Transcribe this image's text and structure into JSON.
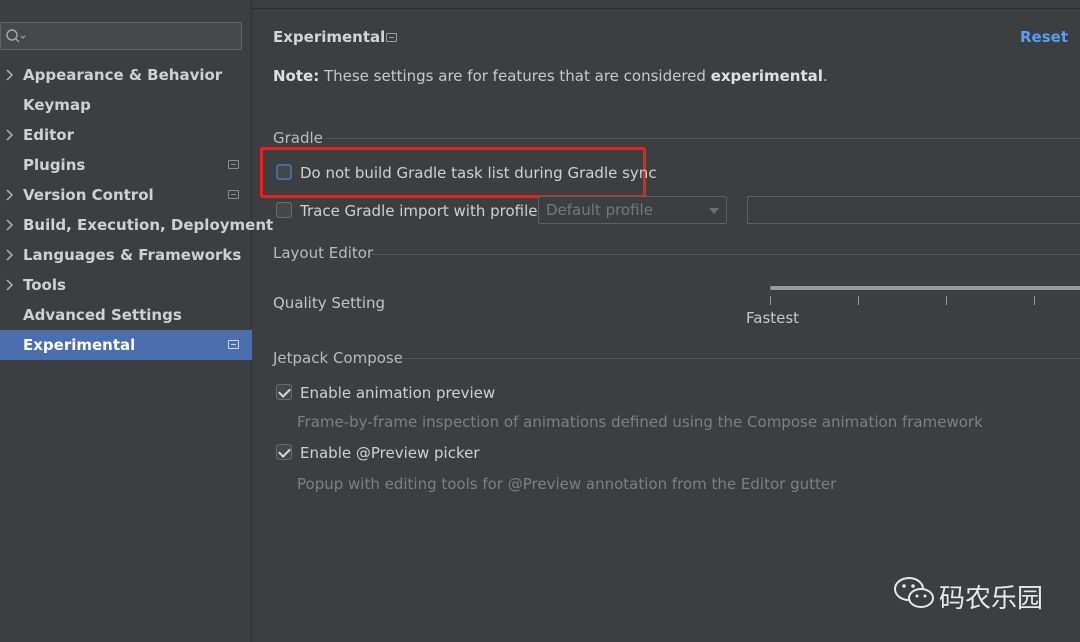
{
  "sidebar": {
    "search": {
      "value": "",
      "placeholder": ""
    },
    "items": [
      {
        "label": "Appearance & Behavior",
        "has_children": true,
        "badge": false,
        "selected": false
      },
      {
        "label": "Keymap",
        "has_children": false,
        "badge": false,
        "selected": false
      },
      {
        "label": "Editor",
        "has_children": true,
        "badge": false,
        "selected": false
      },
      {
        "label": "Plugins",
        "has_children": false,
        "badge": true,
        "selected": false
      },
      {
        "label": "Version Control",
        "has_children": true,
        "badge": true,
        "selected": false
      },
      {
        "label": "Build, Execution, Deployment",
        "has_children": true,
        "badge": false,
        "selected": false
      },
      {
        "label": "Languages & Frameworks",
        "has_children": true,
        "badge": false,
        "selected": false
      },
      {
        "label": "Tools",
        "has_children": true,
        "badge": false,
        "selected": false
      },
      {
        "label": "Advanced Settings",
        "has_children": false,
        "badge": false,
        "selected": false
      },
      {
        "label": "Experimental",
        "has_children": false,
        "badge": true,
        "selected": true
      }
    ]
  },
  "header": {
    "title": "Experimental",
    "reset_label": "Reset",
    "note_prefix": "Note:",
    "note_body": " These settings are for features that are considered ",
    "note_emphasis": "experimental",
    "note_suffix": "."
  },
  "gradle": {
    "section_title": "Gradle",
    "no_build_task_list": {
      "label": "Do not build Gradle task list during Gradle sync",
      "checked": false
    },
    "trace_import": {
      "label": "Trace Gradle import with profile:",
      "checked": false
    },
    "profile_combo": {
      "value": "Default profile"
    },
    "profile_path": {
      "value": ""
    }
  },
  "layout_editor": {
    "section_title": "Layout Editor",
    "quality_label": "Quality Setting",
    "slider_value_label": "Fastest",
    "slider_position": 1.0
  },
  "compose": {
    "section_title": "Jetpack Compose",
    "animation_preview": {
      "label": "Enable animation preview",
      "checked": true,
      "description": "Frame-by-frame inspection of animations defined using the Compose animation framework"
    },
    "preview_picker": {
      "label": "Enable @Preview picker",
      "checked": true,
      "description": "Popup with editing tools for @Preview annotation from the Editor gutter"
    }
  },
  "watermark": {
    "text": "码农乐园",
    "icon": "wechat-icon"
  },
  "colors": {
    "selection": "#4b6eaf",
    "link": "#589df6",
    "highlight_box": "#e8221f",
    "background": "#3c3f41"
  }
}
